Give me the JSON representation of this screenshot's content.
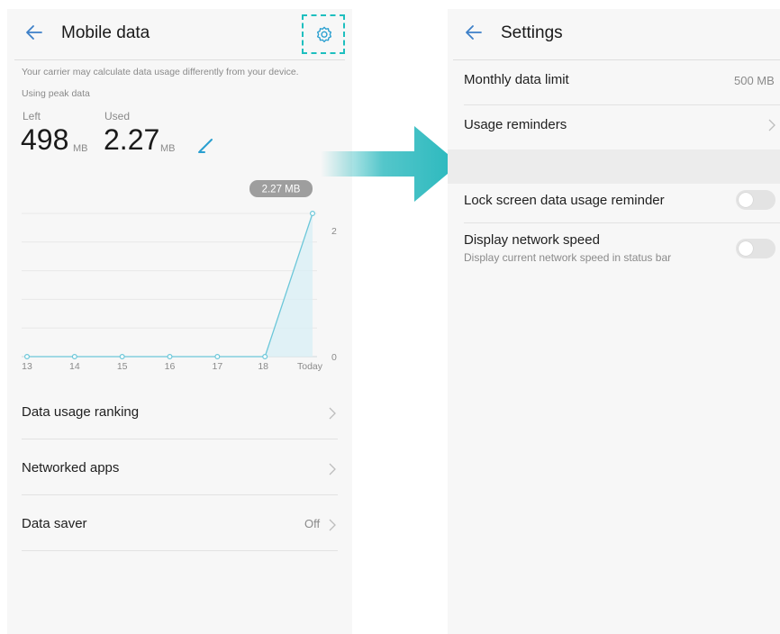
{
  "colors": {
    "accent": "#1ebfbf",
    "arrow": "#29b8bd",
    "chart_line": "#6cc7d9",
    "chart_fill": "#d9eff5"
  },
  "left_screen": {
    "title": "Mobile data",
    "back_icon": "arrow-left-icon",
    "settings_icon": "gear-icon",
    "notice": "Your carrier may calculate data usage differently from your device.",
    "status": "Using peak data",
    "left_label": "Left",
    "left_value": "498",
    "left_unit": "MB",
    "used_label": "Used",
    "used_value": "2.27",
    "used_unit": "MB",
    "edit_icon": "pencil-icon",
    "list": [
      {
        "label": "Data usage ranking",
        "value": ""
      },
      {
        "label": "Networked apps",
        "value": ""
      },
      {
        "label": "Data saver",
        "value": "Off"
      }
    ]
  },
  "chart_data": {
    "type": "area",
    "x": [
      "13",
      "14",
      "15",
      "16",
      "17",
      "18",
      "Today"
    ],
    "series": [
      {
        "values": [
          0,
          0,
          0,
          0,
          0,
          0,
          2.27
        ]
      }
    ],
    "y_ticks": [
      "2",
      "0"
    ],
    "ylim": [
      0,
      2.27
    ],
    "tooltip": "2.27 MB",
    "grid": true
  },
  "right_screen": {
    "title": "Settings",
    "back_icon": "arrow-left-icon",
    "items": [
      {
        "label": "Monthly data limit",
        "value": "500 MB"
      },
      {
        "label": "Usage reminders",
        "value": ""
      },
      {
        "label": "Lock screen data usage reminder",
        "toggle": false
      },
      {
        "label": "Display network speed",
        "sublabel": "Display current network speed in status bar",
        "toggle": false
      }
    ]
  }
}
